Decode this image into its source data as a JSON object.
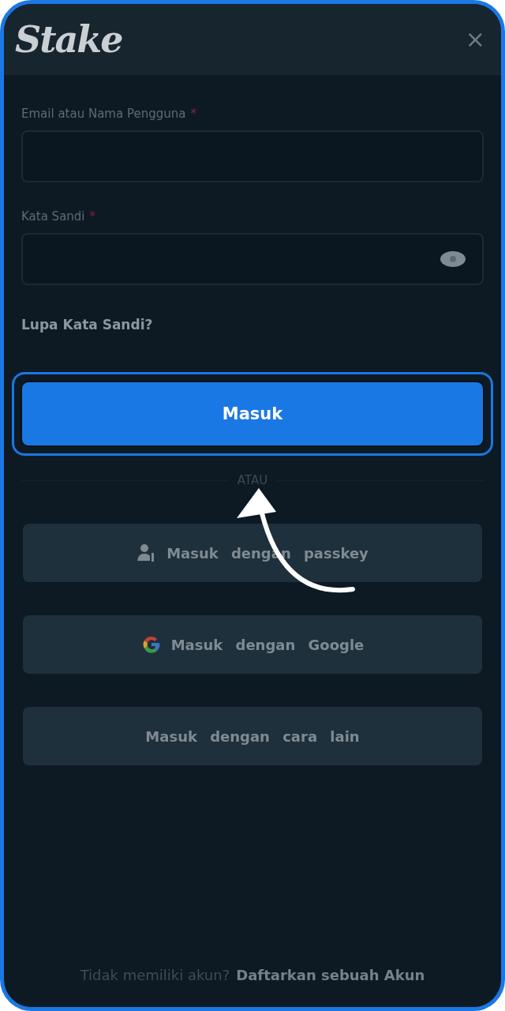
{
  "header": {
    "logo": "Stake",
    "close": "×"
  },
  "fields": [
    {
      "label": "Email atau Nama Pengguna",
      "required_mark": "*",
      "kind": "text"
    },
    {
      "label": "Kata Sandi",
      "required_mark": "*",
      "kind": "password"
    }
  ],
  "forgot_link": "Lupa Kata Sandi?",
  "submit": {
    "label": "Masuk",
    "highlighted": true
  },
  "divider": "ATAU",
  "alt_buttons": [
    {
      "label": "Masuk dengan passkey",
      "kind": "passkey"
    },
    {
      "label": "Masuk dengan Google",
      "kind": "google"
    },
    {
      "label": "Masuk dengan cara lain",
      "kind": "plain"
    }
  ],
  "footer": {
    "text": "Tidak memiliki akun?",
    "link": "Daftarkan sebuah Akun"
  }
}
